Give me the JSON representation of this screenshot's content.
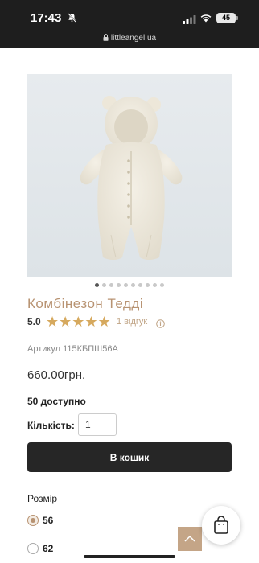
{
  "status_bar": {
    "time": "17:43",
    "battery": "45"
  },
  "browser": {
    "url": "littleangel.ua"
  },
  "product": {
    "title": "Комбінезон Тедді",
    "rating": "5.0",
    "stars": "★★★★★",
    "reviews": "1 відгук",
    "sku": "Артикул 115КБПШ56А",
    "price": "660.00грн.",
    "stock": "50 доступно",
    "quantity_label": "Кількість:",
    "quantity_value": "1",
    "add_to_cart": "В кошик",
    "size_label": "Розмір",
    "sizes": [
      "56",
      "62"
    ],
    "selected_size": "56"
  },
  "gallery": {
    "slide_count": 10,
    "active_slide": 1
  },
  "colors": {
    "accent": "#b89372",
    "star": "#d6a95e",
    "button": "#262626"
  }
}
